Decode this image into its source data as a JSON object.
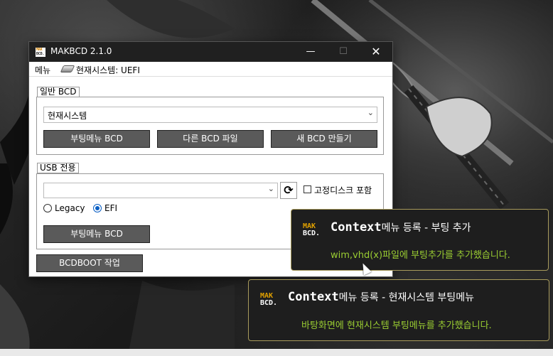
{
  "window": {
    "title": "MAKBCD 2.1.0",
    "icon_text_top": "MAK",
    "icon_text_bottom": "BCD.",
    "controls": {
      "minimize": "—",
      "maximize": "☐",
      "close": "✕"
    }
  },
  "menubar": {
    "menu_label": "메뉴",
    "system_label": "현재시스템: UEFI"
  },
  "group_general": {
    "label": "일반 BCD",
    "select_value": "현재시스템",
    "buttons": [
      "부팅메뉴 BCD",
      "다른 BCD 파일",
      "새 BCD 만들기"
    ]
  },
  "group_usb": {
    "label": "USB 전용",
    "select_value": "",
    "refresh_icon": "⟳",
    "checkbox_label": "고정디스크 포함",
    "checkbox_checked": false,
    "radio_legacy": "Legacy",
    "radio_efi": "EFI",
    "radio_selected": "EFI",
    "button": "부팅메뉴 BCD"
  },
  "bcdboot_button": "BCDBOOT 작업",
  "toasts": [
    {
      "logo_top": "MAK",
      "logo_bottom": "BCD.",
      "title_word": "Context",
      "title_rest": "메뉴 등록 - 부팅 추가",
      "message": "wim,vhd(x)파일에 부팅추가를 추가했습니다."
    },
    {
      "logo_top": "MAK",
      "logo_bottom": "BCD.",
      "title_word": "Context",
      "title_rest": "메뉴 등록 - 현재시스템 부팅메뉴",
      "message": "바탕화면에 현재시스템 부팅메뉴를 추가했습니다."
    }
  ],
  "colors": {
    "toast_border": "#a89b5c",
    "toast_message": "#9acd32",
    "radio_accent": "#0a5fc4",
    "button_bg": "#5a5a5a"
  }
}
